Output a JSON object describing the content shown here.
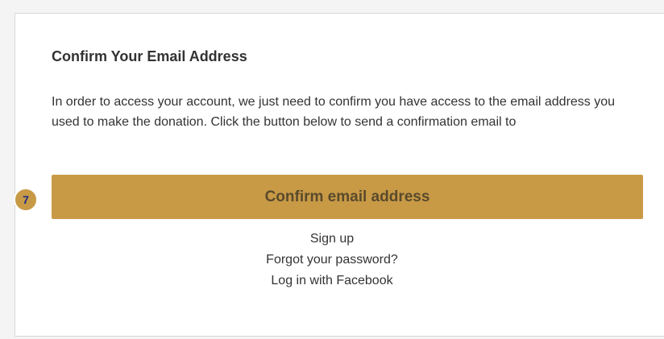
{
  "confirm": {
    "title": "Confirm Your Email Address",
    "description": "In order to access your account, we just need to confirm you have access to the email address you used to make the donation. Click the button below to send a confirmation email to",
    "button_label": "Confirm email address"
  },
  "links": {
    "sign_up": "Sign up",
    "forgot_password": "Forgot your password?",
    "facebook_login": "Log in with Facebook"
  },
  "marker": {
    "label": "7"
  },
  "colors": {
    "accent": "#c89a46",
    "text": "#333333",
    "marker_text": "#1a2a8a"
  }
}
